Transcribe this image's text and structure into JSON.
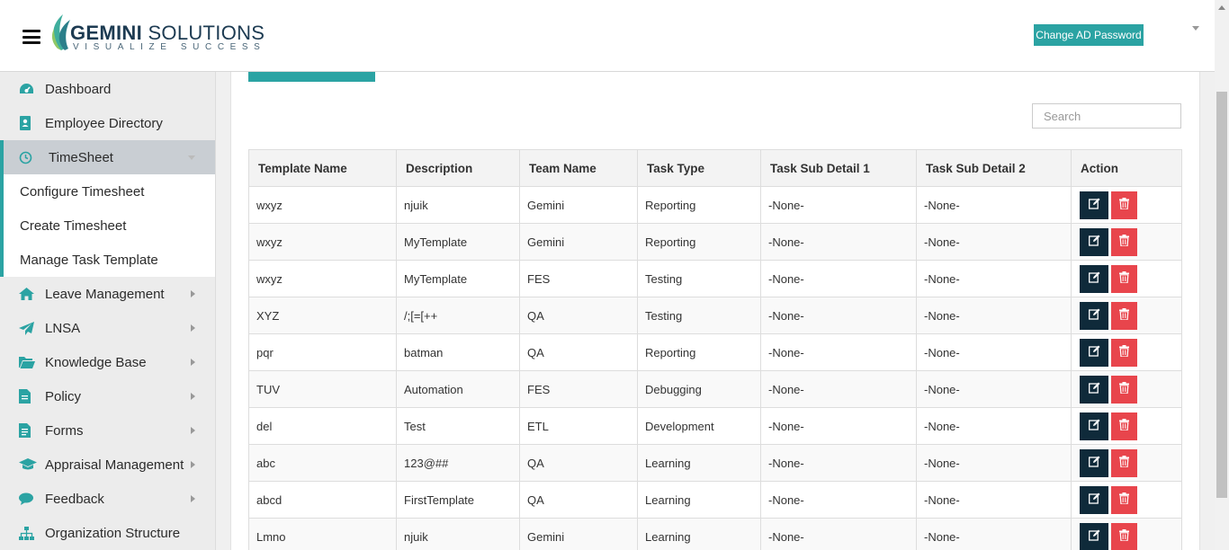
{
  "header": {
    "logo_main_bold": "GEMINI",
    "logo_main_rest": " SOLUTIONS",
    "logo_tagline": "VISUALIZE SUCCESS",
    "change_password_label": "Change AD Password"
  },
  "sidebar": {
    "items": [
      {
        "label": "Dashboard",
        "icon": "dashboard-icon"
      },
      {
        "label": "Employee Directory",
        "icon": "address-book-icon"
      },
      {
        "label": "TimeSheet",
        "icon": "clock-icon",
        "active": true
      },
      {
        "label": "Leave Management",
        "icon": "home-icon"
      },
      {
        "label": "LNSA",
        "icon": "paper-plane-icon"
      },
      {
        "label": "Knowledge Base",
        "icon": "folder-open-icon"
      },
      {
        "label": "Policy",
        "icon": "document-icon"
      },
      {
        "label": "Forms",
        "icon": "form-icon"
      },
      {
        "label": "Appraisal Management",
        "icon": "graduation-cap-icon"
      },
      {
        "label": "Feedback",
        "icon": "comments-icon"
      },
      {
        "label": "Organization Structure",
        "icon": "sitemap-icon"
      }
    ],
    "timesheet_sub": [
      {
        "label": "Configure Timesheet"
      },
      {
        "label": "Create Timesheet"
      },
      {
        "label": "Manage Task Template"
      }
    ]
  },
  "search": {
    "placeholder": "Search",
    "value": ""
  },
  "table": {
    "headers": [
      "Template Name",
      "Description",
      "Team Name",
      "Task Type",
      "Task Sub Detail 1",
      "Task Sub Detail 2",
      "Action"
    ],
    "rows": [
      [
        "wxyz",
        "njuik",
        "Gemini",
        "Reporting",
        "-None-",
        "-None-"
      ],
      [
        "wxyz",
        "MyTemplate",
        "Gemini",
        "Reporting",
        "-None-",
        "-None-"
      ],
      [
        "wxyz",
        "MyTemplate",
        "FES",
        "Testing",
        "-None-",
        "-None-"
      ],
      [
        "XYZ",
        "/;[=[++",
        "QA",
        "Testing",
        "-None-",
        "-None-"
      ],
      [
        "pqr",
        "batman",
        "QA",
        "Reporting",
        "-None-",
        "-None-"
      ],
      [
        "TUV",
        "Automation",
        "FES",
        "Debugging",
        "-None-",
        "-None-"
      ],
      [
        "del",
        "Test",
        "ETL",
        "Development",
        "-None-",
        "-None-"
      ],
      [
        "abc",
        "123@##",
        "QA",
        "Learning",
        "-None-",
        "-None-"
      ],
      [
        "abcd",
        "FirstTemplate",
        "QA",
        "Learning",
        "-None-",
        "-None-"
      ],
      [
        "Lmno",
        "njuik",
        "Gemini",
        "Learning",
        "-None-",
        "-None-"
      ]
    ]
  },
  "colors": {
    "accent": "#2ba3a3",
    "edit_button": "#0f2a3a",
    "delete_button": "#e8454c"
  }
}
